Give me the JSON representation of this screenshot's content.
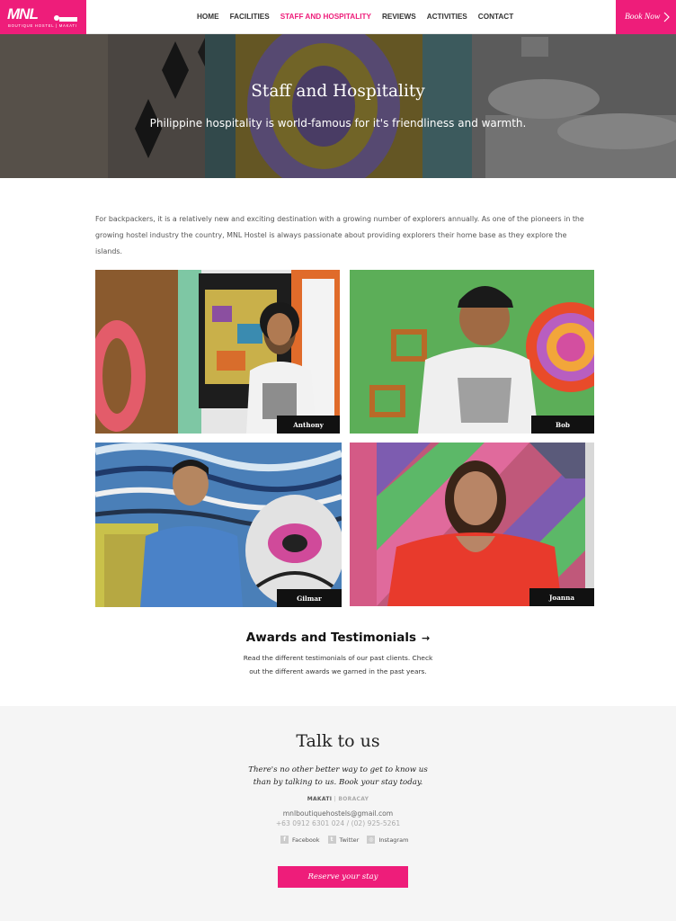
{
  "brand": {
    "logo_text": "MNL",
    "tagline": "BOUTIQUE HOSTEL | MAKATI",
    "accent_color": "#ee1d7a"
  },
  "nav": {
    "items": [
      {
        "label": "HOME",
        "active": false
      },
      {
        "label": "FACILITIES",
        "active": false
      },
      {
        "label": "STAFF AND HOSPITALITY",
        "active": true
      },
      {
        "label": "REVIEWS",
        "active": false
      },
      {
        "label": "ACTIVITIES",
        "active": false
      },
      {
        "label": "CONTACT",
        "active": false
      }
    ],
    "book_now": "Book Now",
    "book_now_icon": "chevron-right-icon"
  },
  "hero": {
    "title": "Staff and Hospitality",
    "subtitle": "Philippine hospitality is world-famous for it's friendliness and warmth."
  },
  "intro": "For backpackers, it is a relatively new and exciting destination with a growing number of explorers annually. As one of the pioneers in the growing hostel industry the country, MNL Hostel is always passionate about providing explorers their home base as they explore the islands.",
  "staff": [
    {
      "name": "Anthony"
    },
    {
      "name": "Bob"
    },
    {
      "name": "Gilmar"
    },
    {
      "name": "Joanna"
    }
  ],
  "awards": {
    "title": "Awards and Testimonials",
    "arrow_icon": "arrow-right-icon",
    "text": "Read the different testimonials of our past clients. Check out the different awards we garned in the past years."
  },
  "contact": {
    "title": "Talk to us",
    "subtitle": "There's no other better way to get to know us than by talking to us. Book your stay today.",
    "location_active": "MAKATI",
    "location_separator": "|",
    "location_other": "BORACAY",
    "email": "mnlboutiquehostels@gmail.com",
    "phone": "+63 0912 6301 024 / (02) 925-5261",
    "social": [
      {
        "label": "Facebook",
        "icon": "facebook-icon"
      },
      {
        "label": "Twitter",
        "icon": "twitter-icon"
      },
      {
        "label": "Instagram",
        "icon": "instagram-icon"
      }
    ],
    "cta": "Reserve your stay"
  }
}
